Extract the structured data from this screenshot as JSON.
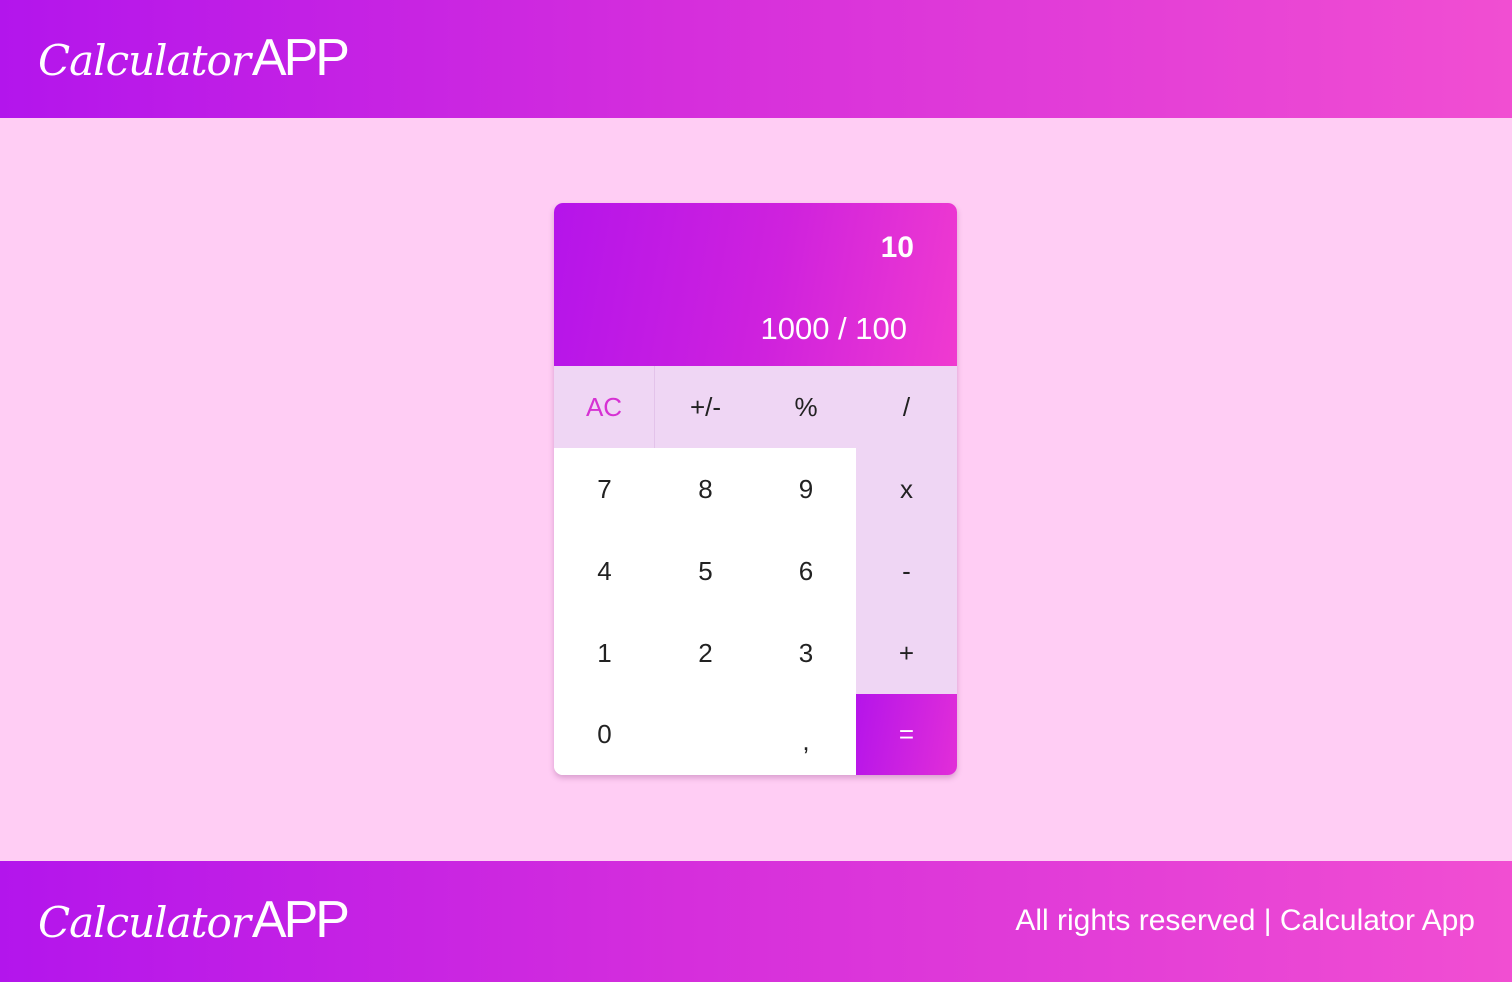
{
  "header": {
    "logo_script": "Calculator",
    "logo_strong": "APP"
  },
  "calculator": {
    "result": "10",
    "expression": "1000 / 100",
    "keys": {
      "ac": "AC",
      "plus_minus": "+/-",
      "percent": "%",
      "divide": "/",
      "seven": "7",
      "eight": "8",
      "nine": "9",
      "multiply": "x",
      "four": "4",
      "five": "5",
      "six": "6",
      "minus": "-",
      "one": "1",
      "two": "2",
      "three": "3",
      "plus": "+",
      "zero": "0",
      "comma": ",",
      "equals": "="
    }
  },
  "footer": {
    "logo_script": "Calculator",
    "logo_strong": "APP",
    "copyright": "All rights reserved | Calculator App"
  },
  "colors": {
    "page_background": "#ffcdf4",
    "gradient_start": "#b315ec",
    "gradient_end": "#f14ed2",
    "key_function_bg": "#efd6f4",
    "ac_text": "#d631d3"
  }
}
